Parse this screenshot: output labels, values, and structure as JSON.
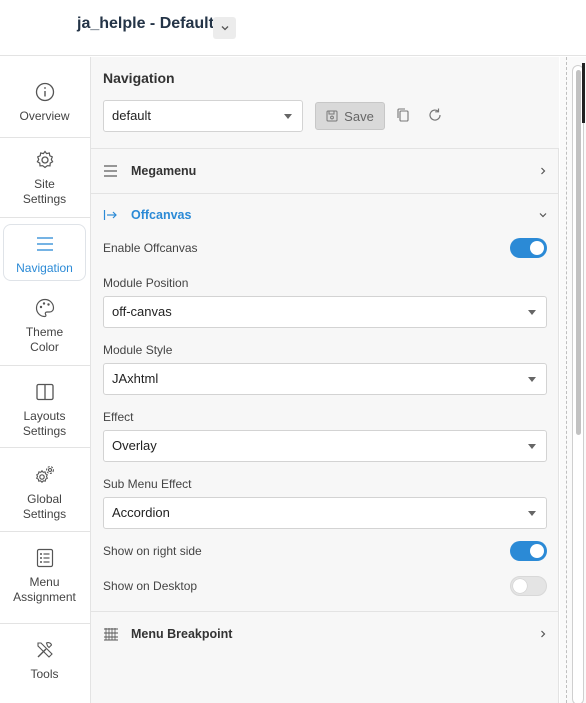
{
  "header": {
    "title": "ja_helple - Default"
  },
  "sidebar": {
    "items": [
      {
        "label": "Overview",
        "icon": "info-icon"
      },
      {
        "label": "Site Settings",
        "icon": "gear-icon"
      },
      {
        "label": "Navigation",
        "icon": "menu-icon",
        "active": true
      },
      {
        "label": "Theme Color",
        "icon": "palette-icon"
      },
      {
        "label": "Layouts Settings",
        "icon": "layout-icon"
      },
      {
        "label": "Global Settings",
        "icon": "gears-icon"
      },
      {
        "label": "Menu Assignment",
        "icon": "list-icon"
      },
      {
        "label": "Tools",
        "icon": "tools-icon"
      }
    ]
  },
  "panel": {
    "title": "Navigation",
    "profile_select": "default",
    "save_label": "Save",
    "sections": {
      "megamenu": {
        "label": "Megamenu"
      },
      "offcanvas": {
        "label": "Offcanvas",
        "enable_label": "Enable Offcanvas",
        "enable_value": true,
        "module_position_label": "Module Position",
        "module_position_value": "off-canvas",
        "module_style_label": "Module Style",
        "module_style_value": "JAxhtml",
        "effect_label": "Effect",
        "effect_value": "Overlay",
        "sub_menu_effect_label": "Sub Menu Effect",
        "sub_menu_effect_value": "Accordion",
        "right_side_label": "Show on right side",
        "right_side_value": true,
        "desktop_label": "Show on Desktop",
        "desktop_value": false
      },
      "breakpoint": {
        "label": "Menu Breakpoint"
      }
    }
  },
  "colors": {
    "accent": "#2b8ad6",
    "text": "#333333",
    "border": "#e3e3e3"
  }
}
